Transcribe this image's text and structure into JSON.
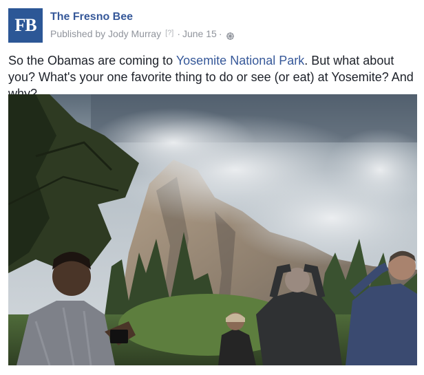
{
  "header": {
    "avatar_text": "FB",
    "page_name": "The Fresno Bee",
    "published_by": "Published by Jody Murray",
    "help_marker": "[?]",
    "separator": "·",
    "date": "June 15",
    "audience_icon": "globe-icon"
  },
  "post": {
    "text_part1": "So the Obamas are coming to ",
    "link_text": "Yosemite National Park",
    "text_part2": ". But what about you? What's your one favorite thing to do or see (or eat) at Yosemite? And why?"
  },
  "photo": {
    "subject": "tourists-looking-up-at-el-capitan-in-clouds"
  },
  "colors": {
    "brand_blue": "#2c5796",
    "link_blue": "#365899",
    "meta_gray": "#90949c",
    "text": "#1d2129"
  }
}
